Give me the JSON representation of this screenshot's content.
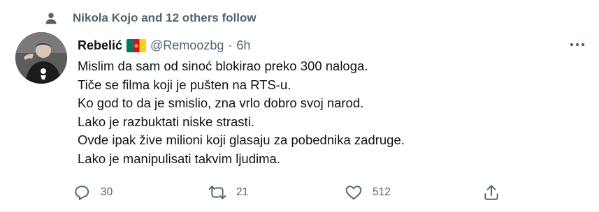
{
  "social_context": {
    "text": "Nikola Kojo and 12 others follow",
    "icon": "person-icon"
  },
  "tweet": {
    "author_name": "Rebelić",
    "flag_icon": "cameroon-flag-icon",
    "handle": "@Remoozbg",
    "separator": "·",
    "time": "6h",
    "lines": [
      "Mislim da sam od sinoć blokirao preko 300 naloga.",
      "Tiče se filma koji je pušten na RTS-u.",
      "Ko god to da je smislio, zna vrlo dobro svoj narod.",
      "Lako je razbuktati niske strasti.",
      "Ovde ipak žive milioni koji glasaju za pobednika zadruge.",
      "Lako je manipulisati takvim ljudima."
    ]
  },
  "actions": {
    "reply_count": "30",
    "retweet_count": "21",
    "like_count": "512"
  },
  "colors": {
    "text_primary": "#0f1419",
    "text_secondary": "#536471"
  }
}
